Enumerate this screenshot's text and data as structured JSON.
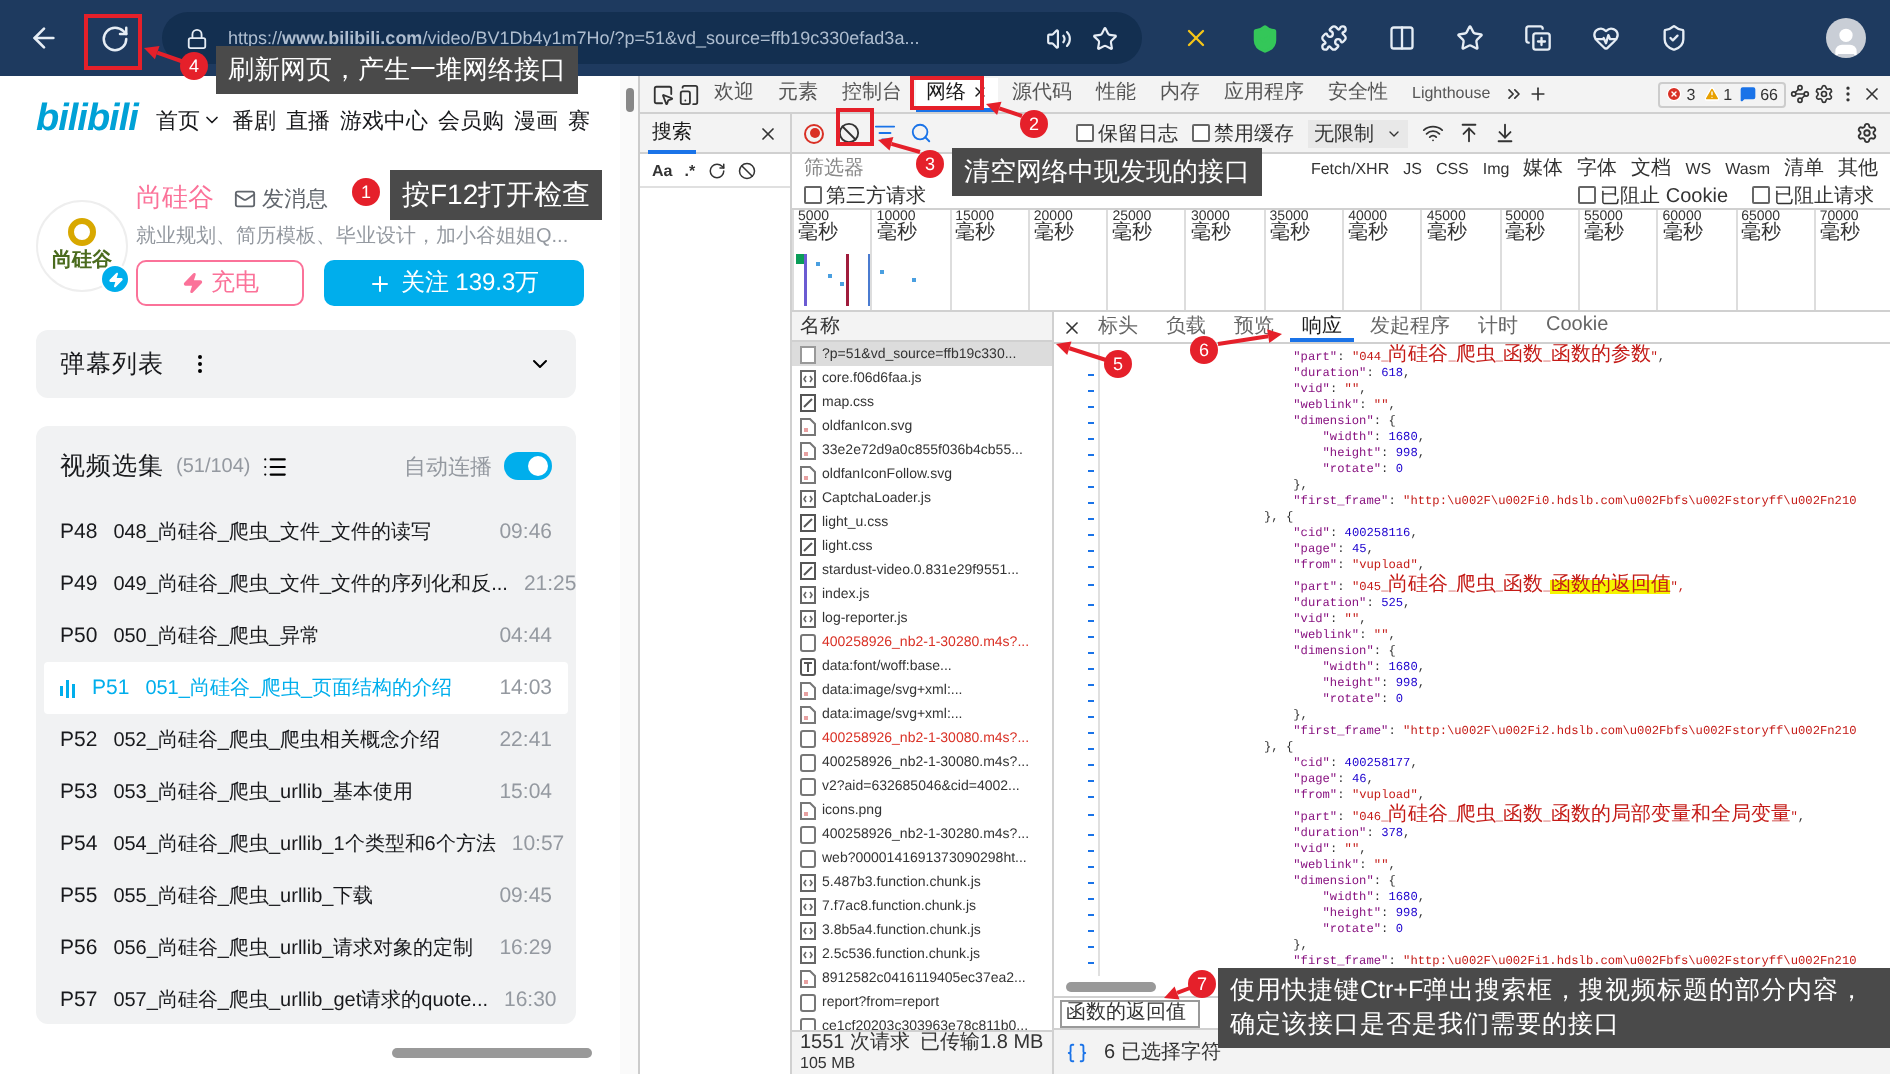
{
  "browser": {
    "url": "https://**www.bilibili.com**/video/BV1Db4y1m7Ho/?p=51&vd_source=ffb19c330efad3a..."
  },
  "page": {
    "logo": "bilibili",
    "nav": [
      {
        "label": "首页",
        "dropdown": true
      },
      {
        "label": "番剧",
        "dropdown": false
      },
      {
        "label": "直播",
        "dropdown": false
      },
      {
        "label": "游戏中心",
        "dropdown": false
      },
      {
        "label": "会员购",
        "dropdown": false
      },
      {
        "label": "漫画",
        "dropdown": false
      },
      {
        "label": "赛",
        "dropdown": false
      }
    ],
    "uploader": {
      "avatar_text": "尚硅谷",
      "name": "尚硅谷",
      "message": "发消息",
      "bio": "就业规划、简历模板、毕业设计，加小谷姐姐Q...",
      "charge": "充电",
      "follow": "关注 139.3万"
    },
    "danmaku": {
      "title": "弹幕列表",
      "expanded": false
    },
    "playlist": {
      "title": "视频选集",
      "count": "(51/104)",
      "autoplay_label": "自动连播",
      "autoplay": true,
      "items": [
        {
          "part": "P48",
          "title": "048_尚硅谷_爬虫_文件_文件的读写",
          "duration": "09:46",
          "selected": false
        },
        {
          "part": "P49",
          "title": "049_尚硅谷_爬虫_文件_文件的序列化和反...",
          "duration": "21:25",
          "selected": false
        },
        {
          "part": "P50",
          "title": "050_尚硅谷_爬虫_异常",
          "duration": "04:44",
          "selected": false
        },
        {
          "part": "P51",
          "title": "051_尚硅谷_爬虫_页面结构的介绍",
          "duration": "14:03",
          "selected": true
        },
        {
          "part": "P52",
          "title": "052_尚硅谷_爬虫_爬虫相关概念介绍",
          "duration": "22:41",
          "selected": false
        },
        {
          "part": "P53",
          "title": "053_尚硅谷_爬虫_urllib_基本使用",
          "duration": "15:04",
          "selected": false
        },
        {
          "part": "P54",
          "title": "054_尚硅谷_爬虫_urllib_1个类型和6个方法",
          "duration": "10:57",
          "selected": false
        },
        {
          "part": "P55",
          "title": "055_尚硅谷_爬虫_urllib_下载",
          "duration": "09:45",
          "selected": false
        },
        {
          "part": "P56",
          "title": "056_尚硅谷_爬虫_urllib_请求对象的定制",
          "duration": "16:29",
          "selected": false
        },
        {
          "part": "P57",
          "title": "057_尚硅谷_爬虫_urllib_get请求的quote...",
          "duration": "16:30",
          "selected": false
        }
      ]
    }
  },
  "devtools": {
    "tabs": [
      {
        "label": "欢迎",
        "selected": false,
        "closable": false
      },
      {
        "label": "元素",
        "selected": false,
        "closable": false
      },
      {
        "label": "控制台",
        "selected": false,
        "closable": false
      },
      {
        "label": "网络",
        "selected": true,
        "closable": true
      },
      {
        "label": "源代码",
        "selected": false,
        "closable": false
      },
      {
        "label": "性能",
        "selected": false,
        "closable": false
      },
      {
        "label": "内存",
        "selected": false,
        "closable": false
      },
      {
        "label": "应用程序",
        "selected": false,
        "closable": false
      },
      {
        "label": "安全性",
        "selected": false,
        "closable": false
      },
      {
        "label": "Lighthouse",
        "selected": false,
        "closable": false
      }
    ],
    "errors": "3",
    "warnings": "1",
    "issues": "66",
    "search_pane": {
      "title": "搜索",
      "case_label": "Aa",
      "regex_label": ".*"
    },
    "toolbar": {
      "recording": true,
      "options": [
        {
          "label": "保留日志",
          "checked": false
        },
        {
          "label": "禁用缓存",
          "checked": false
        }
      ],
      "throttle": "无限制"
    },
    "filter": {
      "placeholder": "筛选器",
      "types": [
        "Fetch/XHR",
        "JS",
        "CSS",
        "Img",
        "媒体",
        "字体",
        "文档",
        "WS",
        "Wasm",
        "清单",
        "其他"
      ],
      "checks": [
        {
          "label": "第三方请求",
          "checked": false
        },
        {
          "label": "已阻止 Cookie",
          "checked": false
        },
        {
          "label": "已阻止请求",
          "checked": false
        }
      ]
    },
    "timeline": [
      {
        "value": "5000",
        "unit": "毫秒"
      },
      {
        "value": "10000",
        "unit": "毫秒"
      },
      {
        "value": "15000",
        "unit": "毫秒"
      },
      {
        "value": "20000",
        "unit": "毫秒"
      },
      {
        "value": "25000",
        "unit": "毫秒"
      },
      {
        "value": "30000",
        "unit": "毫秒"
      },
      {
        "value": "35000",
        "unit": "毫秒"
      },
      {
        "value": "40000",
        "unit": "毫秒"
      },
      {
        "value": "45000",
        "unit": "毫秒"
      },
      {
        "value": "50000",
        "unit": "毫秒"
      },
      {
        "value": "55000",
        "unit": "毫秒"
      },
      {
        "value": "60000",
        "unit": "毫秒"
      },
      {
        "value": "65000",
        "unit": "毫秒"
      },
      {
        "value": "70000",
        "unit": "毫秒"
      }
    ],
    "requests": {
      "header": "名称",
      "status": [
        "1551 次请求",
        "已传输1.8 MB",
        "105 MB"
      ],
      "rows": [
        {
          "name": "?p=51&vd_source=ffb19c330...",
          "kind": "doc",
          "selected": true,
          "error": false
        },
        {
          "name": "core.f06d6faa.js",
          "kind": "script",
          "selected": false,
          "error": false
        },
        {
          "name": "map.css",
          "kind": "css",
          "selected": false,
          "error": false
        },
        {
          "name": "oldfanIcon.svg",
          "kind": "image",
          "selected": false,
          "error": false
        },
        {
          "name": "33e2e72d9a0c855f036b4cb55...",
          "kind": "image",
          "selected": false,
          "error": false
        },
        {
          "name": "oldfanIconFollow.svg",
          "kind": "image",
          "selected": false,
          "error": false
        },
        {
          "name": "CaptchaLoader.js",
          "kind": "script",
          "selected": false,
          "error": false
        },
        {
          "name": "light_u.css",
          "kind": "css",
          "selected": false,
          "error": false
        },
        {
          "name": "light.css",
          "kind": "css",
          "selected": false,
          "error": false
        },
        {
          "name": "stardust-video.0.831e29f9551...",
          "kind": "css",
          "selected": false,
          "error": false
        },
        {
          "name": "index.js",
          "kind": "script",
          "selected": false,
          "error": false
        },
        {
          "name": "log-reporter.js",
          "kind": "script",
          "selected": false,
          "error": false
        },
        {
          "name": "400258926_nb2-1-30280.m4s?...",
          "kind": "other",
          "selected": false,
          "error": true
        },
        {
          "name": "data:font/woff:base...",
          "kind": "font",
          "selected": false,
          "error": false
        },
        {
          "name": "data:image/svg+xml:...",
          "kind": "image",
          "selected": false,
          "error": false
        },
        {
          "name": "data:image/svg+xml:...",
          "kind": "image",
          "selected": false,
          "error": false
        },
        {
          "name": "400258926_nb2-1-30080.m4s?...",
          "kind": "other",
          "selected": false,
          "error": true
        },
        {
          "name": "400258926_nb2-1-30080.m4s?...",
          "kind": "other",
          "selected": false,
          "error": false
        },
        {
          "name": "v2?aid=632685046&cid=4002...",
          "kind": "other",
          "selected": false,
          "error": false
        },
        {
          "name": "icons.png",
          "kind": "image",
          "selected": false,
          "error": false
        },
        {
          "name": "400258926_nb2-1-30280.m4s?...",
          "kind": "other",
          "selected": false,
          "error": false
        },
        {
          "name": "web?0000141691373090298ht...",
          "kind": "other",
          "selected": false,
          "error": false
        },
        {
          "name": "5.487b3.function.chunk.js",
          "kind": "script",
          "selected": false,
          "error": false
        },
        {
          "name": "7.f7ac8.function.chunk.js",
          "kind": "script",
          "selected": false,
          "error": false
        },
        {
          "name": "3.8b5a4.function.chunk.js",
          "kind": "script",
          "selected": false,
          "error": false
        },
        {
          "name": "2.5c536.function.chunk.js",
          "kind": "script",
          "selected": false,
          "error": false
        },
        {
          "name": "8912582c0416119405ec37ea2...",
          "kind": "image",
          "selected": false,
          "error": false
        },
        {
          "name": "report?from=report",
          "kind": "other",
          "selected": false,
          "error": false
        },
        {
          "name": "ce1cf20203c303963e78c811b0...",
          "kind": "other",
          "selected": false,
          "error": false
        }
      ]
    },
    "details": {
      "tabs": [
        {
          "label": "标头",
          "selected": false
        },
        {
          "label": "负载",
          "selected": false
        },
        {
          "label": "预览",
          "selected": false
        },
        {
          "label": "响应",
          "selected": true
        },
        {
          "label": "发起程序",
          "selected": false
        },
        {
          "label": "计时",
          "selected": false
        },
        {
          "label": "Cookie",
          "selected": false
        }
      ],
      "lines": [
        {
          "text": "    \"part\": \"044_尚硅谷_爬虫_函数_函数的参数\","
        },
        {
          "text": "    \"duration\": 618,"
        },
        {
          "text": "    \"vid\": \"\","
        },
        {
          "text": "    \"weblink\": \"\","
        },
        {
          "text": "    \"dimension\": {"
        },
        {
          "text": "        \"width\": 1680,"
        },
        {
          "text": "        \"height\": 998,"
        },
        {
          "text": "        \"rotate\": 0"
        },
        {
          "text": "    },"
        },
        {
          "text": "    \"first_frame\": \"http:\\u002F\\u002Fi0.hdslb.com\\u002Fbfs\\u002Fstoryff\\u002Fn210"
        },
        {
          "text": "}, {"
        },
        {
          "text": "    \"cid\": 400258116,"
        },
        {
          "text": "    \"page\": 45,"
        },
        {
          "text": "    \"from\": \"vupload\","
        },
        {
          "text": "    \"part\": \"045_尚硅谷_爬虫_函数_",
          "match": "函数的返回值",
          "after": "\","
        },
        {
          "text": "    \"duration\": 525,"
        },
        {
          "text": "    \"vid\": \"\","
        },
        {
          "text": "    \"weblink\": \"\","
        },
        {
          "text": "    \"dimension\": {"
        },
        {
          "text": "        \"width\": 1680,"
        },
        {
          "text": "        \"height\": 998,"
        },
        {
          "text": "        \"rotate\": 0"
        },
        {
          "text": "    },"
        },
        {
          "text": "    \"first_frame\": \"http:\\u002F\\u002Fi2.hdslb.com\\u002Fbfs\\u002Fstoryff\\u002Fn210"
        },
        {
          "text": "}, {"
        },
        {
          "text": "    \"cid\": 400258177,"
        },
        {
          "text": "    \"page\": 46,"
        },
        {
          "text": "    \"from\": \"vupload\","
        },
        {
          "text": "    \"part\": \"046_尚硅谷_爬虫_函数_函数的局部变量和全局变量\","
        },
        {
          "text": "    \"duration\": 378,"
        },
        {
          "text": "    \"vid\": \"\","
        },
        {
          "text": "    \"weblink\": \"\","
        },
        {
          "text": "    \"dimension\": {"
        },
        {
          "text": "        \"width\": 1680,"
        },
        {
          "text": "        \"height\": 998,"
        },
        {
          "text": "        \"rotate\": 0"
        },
        {
          "text": "    },"
        },
        {
          "text": "    \"first_frame\": \"http:\\u002F\\u002Fi1.hdslb.com\\u002Fbfs\\u002Fstoryff\\u002Fn210"
        }
      ],
      "find": "函数的返回值",
      "status": "6 已选择字符"
    }
  },
  "annotations": [
    {
      "number": "1",
      "text": "按F12打开检查"
    },
    {
      "number": "2"
    },
    {
      "number": "3",
      "text": "清空网络中现发现的接口"
    },
    {
      "number": "4",
      "text": "刷新网页，产生一堆网络接口"
    },
    {
      "number": "5"
    },
    {
      "number": "6"
    },
    {
      "number": "7",
      "text": "使用快捷键Ctr+F弹出搜索框，搜视频标题的部分内容，确定该接口是否是我们需要的接口"
    }
  ]
}
